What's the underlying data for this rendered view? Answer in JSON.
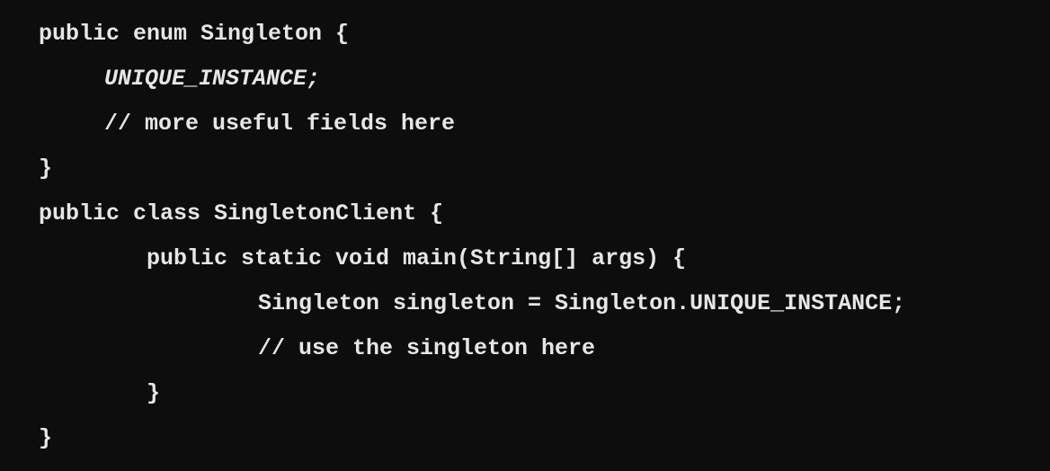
{
  "code": {
    "lines": [
      "public enum Singleton {",
      "UNIQUE_INSTANCE;",
      "// more useful fields here",
      "}",
      "public class SingletonClient {",
      "public static void main(String[] args) {",
      "Singleton singleton = Singleton.UNIQUE_INSTANCE;",
      "// use the singleton here",
      "}",
      "}"
    ]
  }
}
